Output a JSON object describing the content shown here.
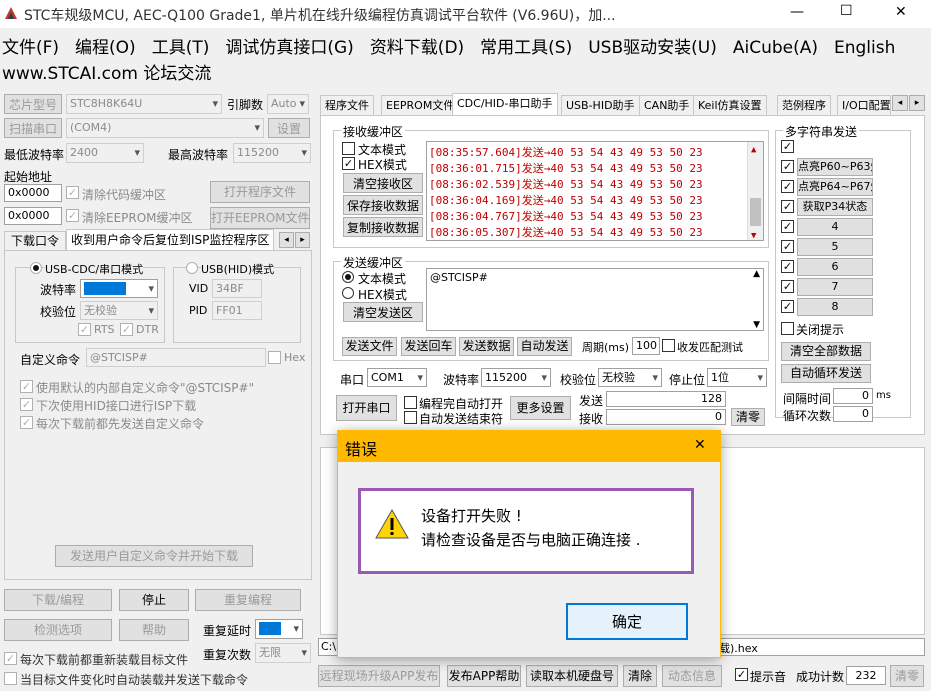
{
  "window": {
    "title": "STC车规级MCU, AEC-Q100 Grade1, 单片机在线升级编程仿真调试平台软件 (V6.96U)，加...",
    "min": "—",
    "max": "☐",
    "close": "✕"
  },
  "menu": [
    "文件(F)",
    "编程(O)",
    "工具(T)",
    "调试仿真接口(G)",
    "资料下载(D)",
    "常用工具(S)",
    "USB驱动安装(U)",
    "AiCube(A)",
    "English"
  ],
  "menu2": "www.STCAI.com 论坛交流",
  "left": {
    "chip_label": "芯片型号",
    "chip_value": "STC8H8K64U",
    "pin_label": "引脚数",
    "pin_value": "Auto",
    "scan_btn": "扫描串口",
    "port_value": "(COM4)",
    "settings_btn": "设置",
    "min_baud_label": "最低波特率",
    "min_baud": "2400",
    "max_baud_label": "最高波特率",
    "max_baud": "115200",
    "start_addr": "起始地址",
    "addr1": "0x0000",
    "clear_code": "清除代码缓冲区",
    "open_prog": "打开程序文件",
    "addr2": "0x0000",
    "clear_eeprom": "清除EEPROM缓冲区",
    "open_eeprom": "打开EEPROM文件",
    "tab1": "下载口令",
    "tab2": "收到用户命令后复位到ISP监控程序区",
    "usb_cdc": "USB-CDC/串口模式",
    "usb_hid": "USB(HID)模式",
    "baud_label": "波特率",
    "baud_value": "115200",
    "parity_label": "校验位",
    "parity_value": "无校验",
    "vid_label": "VID",
    "vid_value": "34BF",
    "pid_label": "PID",
    "pid_value": "FF01",
    "rts": "RTS",
    "dtr": "DTR",
    "custom_cmd_label": "自定义命令",
    "custom_cmd": "@STCISP#",
    "hex": "Hex",
    "opt1": "使用默认的内部自定义命令\"@STCISP#\"",
    "opt2": "下次使用HID接口进行ISP下载",
    "opt3": "每次下载前都先发送自定义命令",
    "send_cmd_btn": "发送用户自定义命令并开始下载",
    "download_btn": "下载/编程",
    "stop_btn": "停止",
    "reprog_btn": "重复编程",
    "check_btn": "检测选项",
    "help_btn": "帮助",
    "delay_label": "重复延时",
    "delay_value": "3 秒",
    "reload_label": "每次下载前都重新装载目标文件",
    "count_label": "重复次数",
    "count_value": "无限",
    "auto_label": "当目标文件变化时自动装载并发送下载命令"
  },
  "tabs": [
    "程序文件",
    "EEPROM文件",
    "CDC/HID-串口助手",
    "USB-HID助手",
    "CAN助手",
    "Keil仿真设置",
    "范例程序",
    "I/O口配置"
  ],
  "recv": {
    "title": "接收缓冲区",
    "text_mode": "文本模式",
    "hex_mode": "HEX模式",
    "clear_btn": "清空接收区",
    "save_btn": "保存接收数据",
    "copy_btn": "复制接收数据",
    "lines": [
      "[08:35:57.604]发送→40 53 54 43 49 53 50 23",
      "[08:36:01.715]发送→40 53 54 43 49 53 50 23",
      "[08:36:02.539]发送→40 53 54 43 49 53 50 23",
      "[08:36:04.169]发送→40 53 54 43 49 53 50 23",
      "[08:36:04.767]发送→40 53 54 43 49 53 50 23",
      "[08:36:05.307]发送→40 53 54 43 49 53 50 23"
    ]
  },
  "send": {
    "title": "发送缓冲区",
    "text_mode": "文本模式",
    "hex_mode": "HEX模式",
    "clear_btn": "清空发送区",
    "content": "@STCISP#",
    "file_btn": "发送文件",
    "cr_btn": "发送回车",
    "data_btn": "发送数据",
    "auto_btn": "自动发送",
    "period_label": "周期(ms)",
    "period_value": "100",
    "match_label": "收发匹配测试"
  },
  "serial": {
    "port_label": "串口",
    "port_value": "COM1",
    "baud_label": "波特率",
    "baud_value": "115200",
    "parity_label": "校验位",
    "parity_value": "无校验",
    "stop_label": "停止位",
    "stop_value": "1位",
    "open_btn": "打开串口",
    "opt_open": "编程完自动打开",
    "opt_end": "自动发送结束符",
    "more_btn": "更多设置",
    "send_label": "发送",
    "send_count": "128",
    "recv_label": "接收",
    "recv_count": "0",
    "clear_btn": "清零"
  },
  "multi": {
    "title": "多字符串发送",
    "items": [
      "",
      "点亮P60~P63灯",
      "点亮P64~P67灯",
      "获取P34状态",
      "4",
      "5",
      "6",
      "7",
      "8"
    ],
    "close_tip": "关闭提示",
    "clear_all": "清空全部数据",
    "auto_loop": "自动循环发送",
    "interval_label": "间隔时间",
    "interval_value": "0",
    "interval_unit": "ms",
    "loop_label": "循环次数",
    "loop_value": "0"
  },
  "status": {
    "path_start": "C:\\",
    "path_end": "载).hex"
  },
  "bottom": {
    "b1": "远程现场升级APP发布",
    "b2": "发布APP帮助",
    "b3": "读取本机硬盘号",
    "b4": "清除",
    "b5": "动态信息",
    "beep": "提示音",
    "count_label": "成功计数",
    "count_value": "232",
    "clear": "清零"
  },
  "dialog": {
    "title": "错误",
    "close": "✕",
    "line1": "设备打开失败 !",
    "line2": "请检查设备是否与电脑正确连接 .",
    "ok": "确定"
  },
  "colors": {
    "dialog_title": "#ffb900",
    "frame": "#9b59b6",
    "highlight": "#0078d7"
  }
}
